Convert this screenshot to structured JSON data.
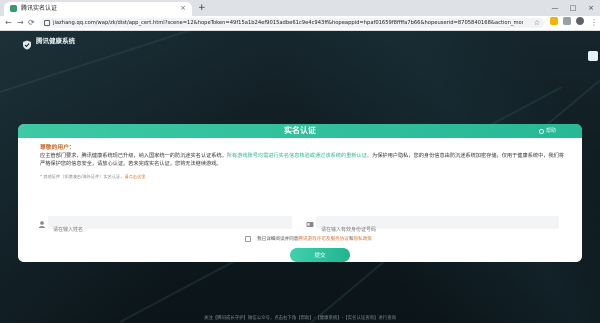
{
  "browser": {
    "tab_title": "腾讯实名认证",
    "tab_close": "×",
    "new_tab": "+",
    "win_minimize": "—",
    "win_maximize": "□",
    "win_close": "×",
    "back": "←",
    "forward": "→",
    "reload": "⟳",
    "url": "jiazhang.qq.com/wap/zk/dist/app_cert.html?scene=12&hopeToken=49f15a1b24ef9015adbe61c9e4c943ff&hopeappid=hpaf01659f8ffffa7b66&hopeuserid=8705840168&action_modal=1&action_ty...",
    "star": "☆",
    "colors": {
      "ext1": "#f4b400",
      "ext2": "#9aa0a6",
      "ext3": "#5f6368"
    }
  },
  "header": {
    "logo_text": "腾讯健康系统"
  },
  "card": {
    "title": "实名认证",
    "help": "帮助",
    "greeting": "尊敬的用户：",
    "body_plain_1": "应主管部门要求，腾讯健康系统现已升级，纳入国家统一的防沉迷实名认证系统。",
    "body_highlight": "所有游戏账号均需进行实名信息核验或通过该系统的重新认证。",
    "body_plain_2": "为保护用户隐私，您的身份信息由防沉迷系统加密存储，仅用于健康系统中，我们将严格保护您的信息安全，请放心认证。若未完成实名认证，您将无法继续游戏。",
    "note_plain": "* 其他证件（如港澳台/海外证件）实名认证，",
    "note_link": "请点击这里",
    "name_placeholder": "请在输入姓名",
    "id_placeholder": "请在输入有效身份证号码",
    "agree_plain": "我已详细阅读并同意",
    "agree_link1": "腾讯游戏许可及服务协议",
    "agree_and": "和",
    "agree_link2": "隐私政策",
    "submit": "提交"
  },
  "footer": {
    "text": "关注【腾讯成长守护】微信公众号，点击右下角【帮助】-【健康系统】-【实名认证查询】进行查询"
  }
}
